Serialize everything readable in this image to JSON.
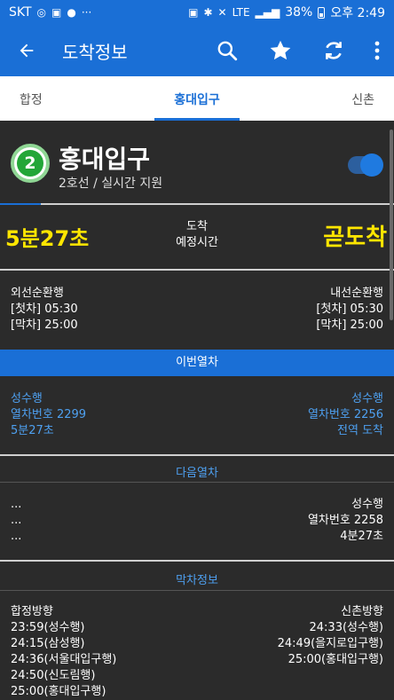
{
  "status_bar": {
    "carrier": "SKT",
    "battery": "38%",
    "time": "오후 2:49",
    "lte": "LTE"
  },
  "app_bar": {
    "title": "도착정보"
  },
  "tabs": {
    "left": "합정",
    "center": "홍대입구",
    "right": "신촌"
  },
  "station": {
    "line_number": "2",
    "name": "홍대입구",
    "subtitle": "2호선 / 실시간 지원",
    "toggle_on": true
  },
  "arrival": {
    "left_time": "5분27초",
    "center_line1": "도착",
    "center_line2": "예정시간",
    "right_status": "곧도착"
  },
  "directions": {
    "left": {
      "title": "외선순환행",
      "first": "[첫차] 05:30",
      "last": "[막차] 25:00"
    },
    "right": {
      "title": "내선순환행",
      "first": "[첫차] 05:30",
      "last": "[막차] 25:00"
    }
  },
  "current_train": {
    "section_label": "이번열차",
    "left": {
      "dest": "성수행",
      "number": "열차번호 2299",
      "status": "5분27초"
    },
    "right": {
      "dest": "성수행",
      "number": "열차번호 2256",
      "status": "전역 도착"
    }
  },
  "next_train": {
    "section_label": "다음열차",
    "left": {
      "line1": "...",
      "line2": "...",
      "line3": "..."
    },
    "right": {
      "dest": "성수행",
      "number": "열차번호 2258",
      "status": "4분27초"
    }
  },
  "last_train": {
    "section_label": "막차정보",
    "left": {
      "title": "합정방향",
      "items": [
        "23:59(성수행)",
        "24:15(삼성행)",
        "24:36(서울대입구행)",
        "24:50(신도림행)",
        "25:00(홍대입구행)"
      ]
    },
    "right": {
      "title": "신촌방향",
      "items": [
        "24:33(성수행)",
        "24:49(을지로입구행)",
        "25:00(홍대입구행)"
      ]
    }
  },
  "colors": {
    "primary": "#1a6fd6",
    "highlight": "#ffe600",
    "line2_green": "#23a638",
    "link_blue": "#4ea0f0",
    "background": "#2b2b2b"
  }
}
